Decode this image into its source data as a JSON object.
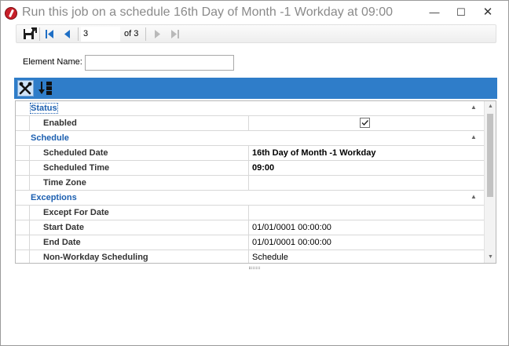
{
  "window": {
    "title": "Run this job on a schedule 16th Day of Month -1 Workday at 09:00",
    "controls": {
      "minimize": "—",
      "maximize": "☐",
      "close": "✕"
    }
  },
  "navigator": {
    "current_page": "3",
    "of_label": "of 3"
  },
  "element_name": {
    "label": "Element Name:",
    "value": ""
  },
  "grid": {
    "categories": [
      {
        "label": "Status",
        "rows": [
          {
            "name": "Enabled",
            "value": "",
            "checked": true
          }
        ]
      },
      {
        "label": "Schedule",
        "rows": [
          {
            "name": "Scheduled Date",
            "value": "16th Day of Month -1 Workday",
            "bold": true
          },
          {
            "name": "Scheduled Time",
            "value": "09:00",
            "bold": true
          },
          {
            "name": "Time Zone",
            "value": ""
          }
        ]
      },
      {
        "label": "Exceptions",
        "rows": [
          {
            "name": "Except For Date",
            "value": ""
          },
          {
            "name": "Start Date",
            "value": "01/01/0001 00:00:00"
          },
          {
            "name": "End Date",
            "value": "01/01/0001 00:00:00"
          },
          {
            "name": "Non-Workday Scheduling",
            "value": "Schedule"
          }
        ]
      }
    ]
  },
  "colors": {
    "toolbar": "#2f7dc9",
    "category_text": "#1c5fb0"
  }
}
